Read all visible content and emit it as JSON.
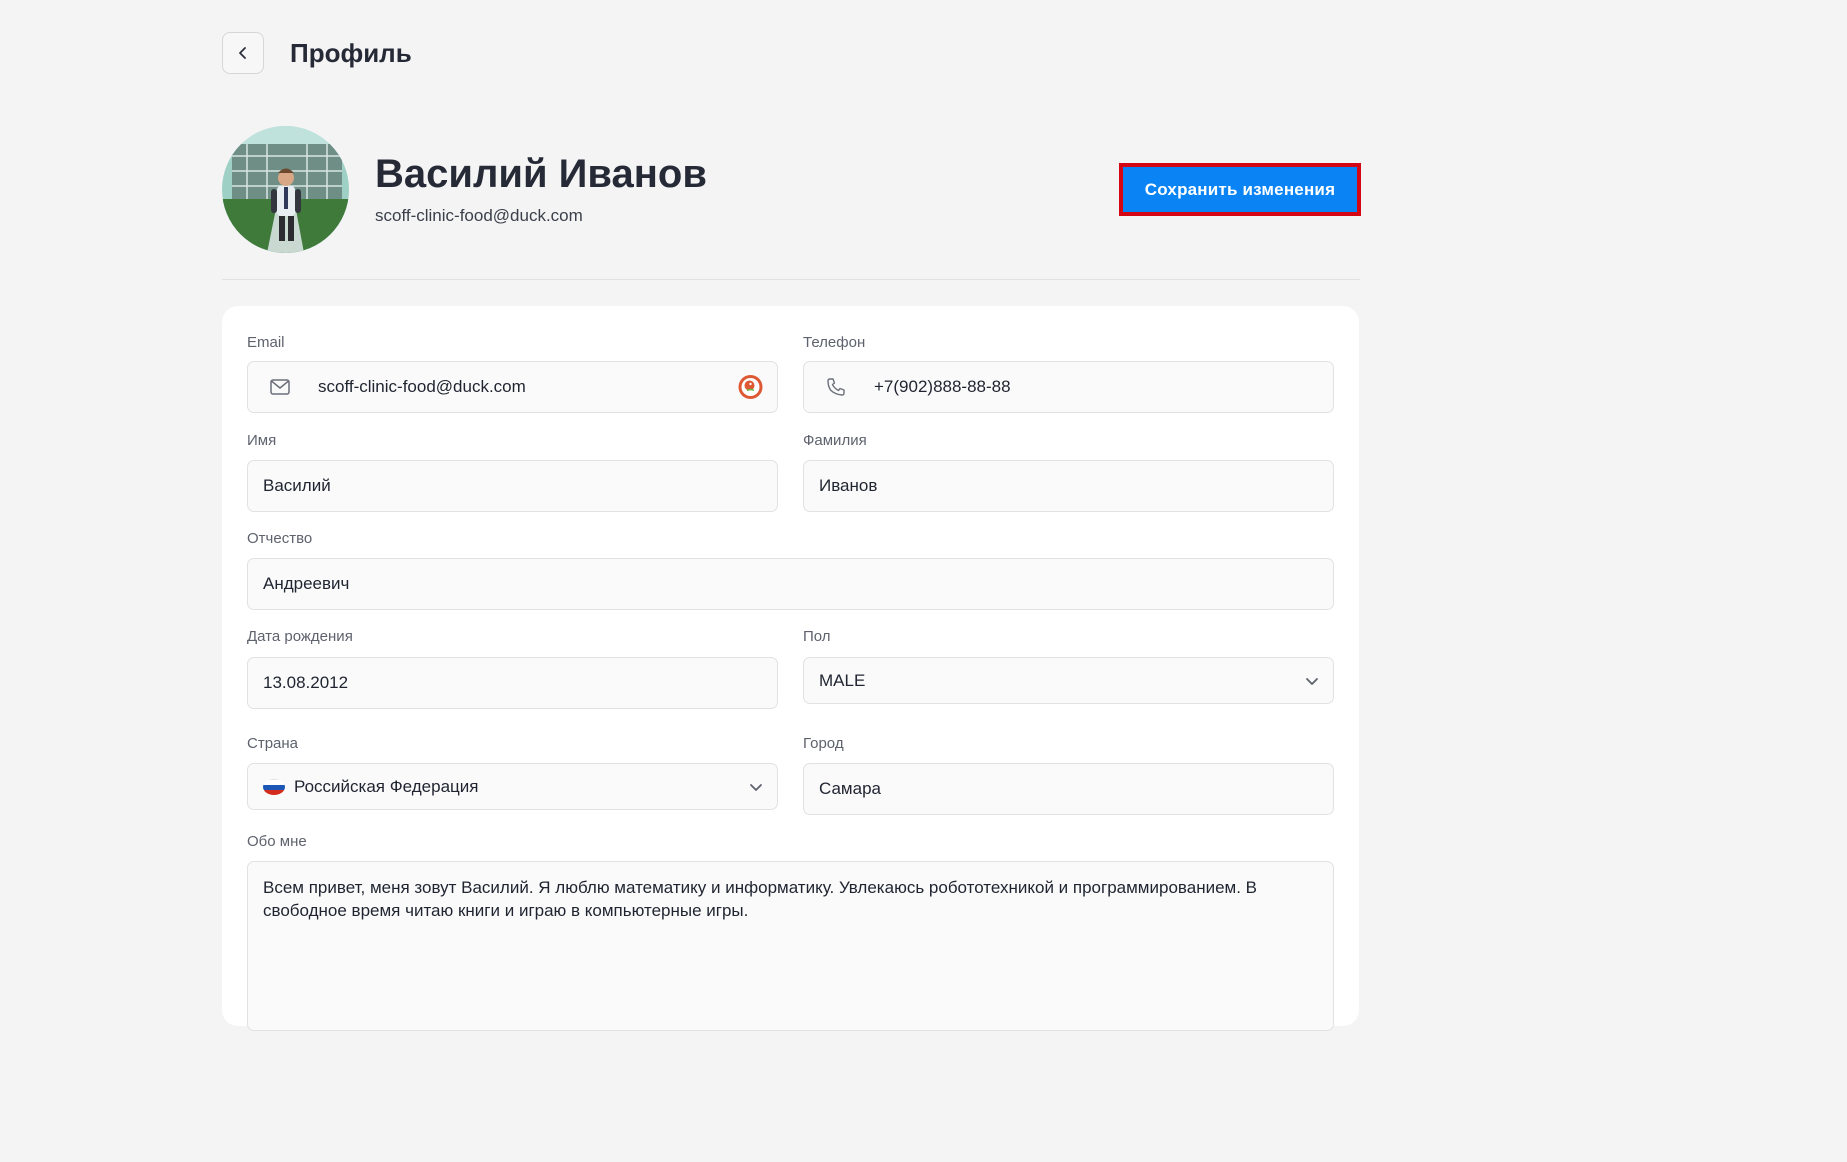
{
  "header": {
    "title": "Профиль"
  },
  "profile": {
    "name": "Василий Иванов",
    "email": "scoff-clinic-food@duck.com",
    "save_label": "Сохранить изменения"
  },
  "form": {
    "email": {
      "label": "Email",
      "value": "scoff-clinic-food@duck.com"
    },
    "phone": {
      "label": "Телефон",
      "value": "+7(902)888-88-88"
    },
    "first_name": {
      "label": "Имя",
      "value": "Василий"
    },
    "last_name": {
      "label": "Фамилия",
      "value": "Иванов"
    },
    "middle_name": {
      "label": "Отчество",
      "value": "Андреевич"
    },
    "birth_date": {
      "label": "Дата рождения",
      "value": "13.08.2012"
    },
    "gender": {
      "label": "Пол",
      "value": "MALE"
    },
    "country": {
      "label": "Страна",
      "value": "Российская Федерация"
    },
    "city": {
      "label": "Город",
      "value": "Самара"
    },
    "about": {
      "label": "Обо мне",
      "value": "Всем привет, меня зовут Василий. Я люблю математику и информатику. Увлекаюсь робототехникой и программированием. В свободное время читаю книги и играю в компьютерные игры."
    }
  },
  "colors": {
    "accent": "#0a84f5",
    "highlight_border": "#d40613",
    "background": "#f4f4f5"
  },
  "icons": [
    "chevron-left-icon",
    "mail-icon",
    "duckduckgo-icon",
    "phone-icon",
    "chevron-down-icon",
    "russia-flag-icon"
  ]
}
